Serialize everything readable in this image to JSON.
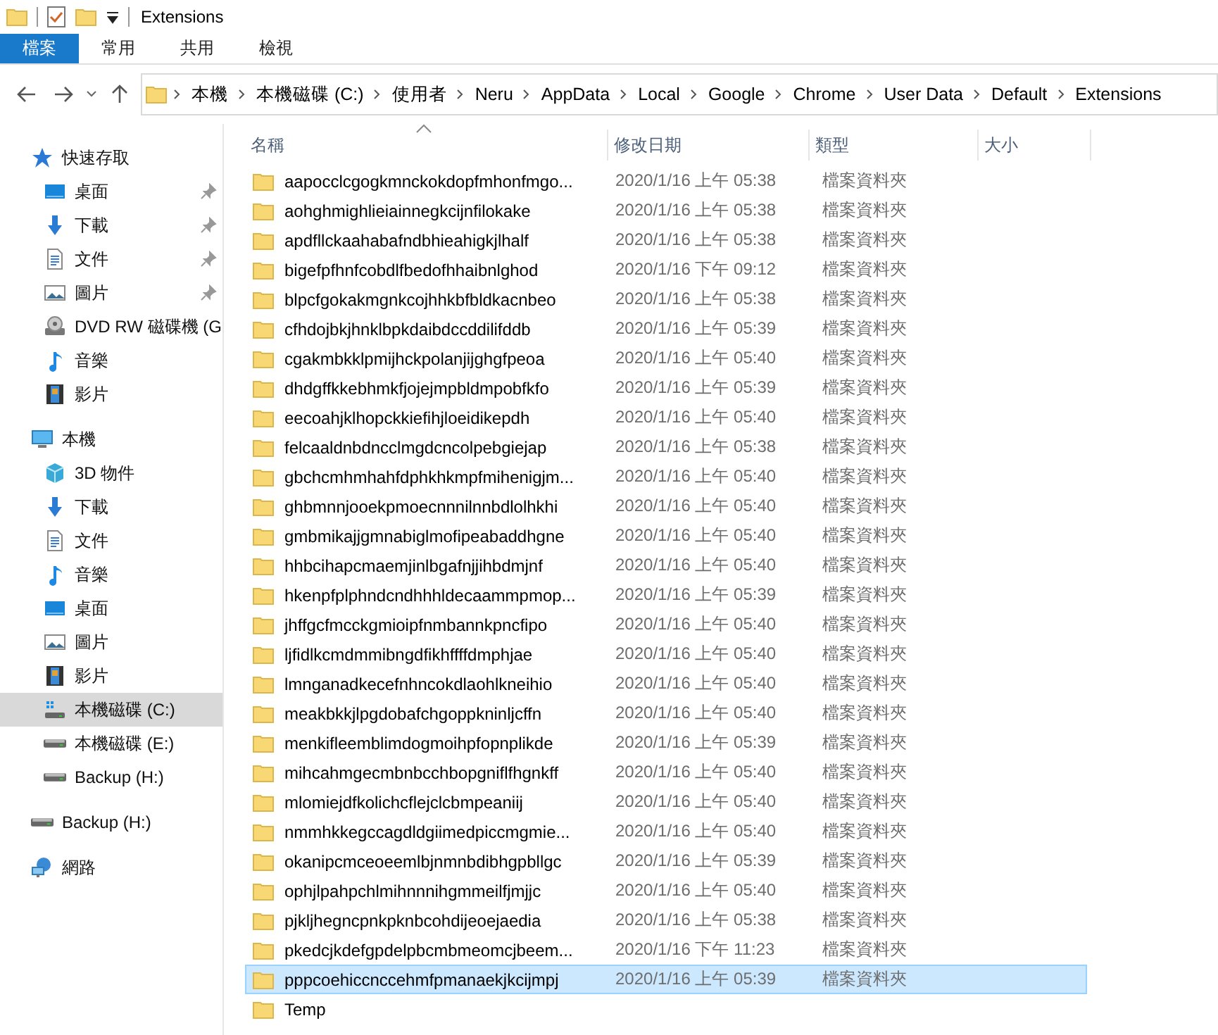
{
  "window": {
    "title": "Extensions"
  },
  "ribbon_tabs": [
    {
      "label": "檔案",
      "selected": true
    },
    {
      "label": "常用",
      "selected": false
    },
    {
      "label": "共用",
      "selected": false
    },
    {
      "label": "檢視",
      "selected": false
    }
  ],
  "address_bar": {
    "segments": [
      "本機",
      "本機磁碟 (C:)",
      "使用者",
      "Neru",
      "AppData",
      "Local",
      "Google",
      "Chrome",
      "User Data",
      "Default",
      "Extensions"
    ]
  },
  "sidebar": {
    "items": [
      {
        "label": "快速存取",
        "kind": "star",
        "selected": false,
        "children": [
          {
            "label": "桌面",
            "kind": "desktop",
            "pinned": true,
            "selected": false
          },
          {
            "label": "下載",
            "kind": "download",
            "pinned": true,
            "selected": false
          },
          {
            "label": "文件",
            "kind": "document",
            "pinned": true,
            "selected": false
          },
          {
            "label": "圖片",
            "kind": "pictures",
            "pinned": true,
            "selected": false
          },
          {
            "label": "DVD RW 磁碟機 (G",
            "kind": "disc",
            "pinned": false,
            "selected": false
          },
          {
            "label": "音樂",
            "kind": "music",
            "pinned": false,
            "selected": false
          },
          {
            "label": "影片",
            "kind": "video",
            "pinned": false,
            "selected": false
          }
        ]
      },
      {
        "label": "本機",
        "kind": "pc",
        "selected": false,
        "children": [
          {
            "label": "3D 物件",
            "kind": "cube",
            "selected": false
          },
          {
            "label": "下載",
            "kind": "download",
            "selected": false
          },
          {
            "label": "文件",
            "kind": "document",
            "selected": false
          },
          {
            "label": "音樂",
            "kind": "music",
            "selected": false
          },
          {
            "label": "桌面",
            "kind": "desktop",
            "selected": false
          },
          {
            "label": "圖片",
            "kind": "pictures",
            "selected": false
          },
          {
            "label": "影片",
            "kind": "video",
            "selected": false
          },
          {
            "label": "本機磁碟 (C:)",
            "kind": "system-drive",
            "selected": true
          },
          {
            "label": "本機磁碟 (E:)",
            "kind": "drive",
            "selected": false
          },
          {
            "label": "Backup  (H:)",
            "kind": "drive",
            "selected": false
          }
        ]
      },
      {
        "label": "Backup  (H:)",
        "kind": "drive",
        "selected": false
      },
      {
        "label": "網路",
        "kind": "network",
        "selected": false
      }
    ]
  },
  "table": {
    "columns": [
      "名稱",
      "修改日期",
      "類型",
      "大小"
    ],
    "rows": [
      {
        "name": "aapocclcgogkmnckokdopfmhonfmgo...",
        "date": "2020/1/16 上午 05:38",
        "type": "檔案資料夾",
        "selected": false
      },
      {
        "name": "aohghmighlieiainnegkcijnfilokake",
        "date": "2020/1/16 上午 05:38",
        "type": "檔案資料夾",
        "selected": false
      },
      {
        "name": "apdfllckaahabafndbhieahigkjlhalf",
        "date": "2020/1/16 上午 05:38",
        "type": "檔案資料夾",
        "selected": false
      },
      {
        "name": "bigefpfhnfcobdlfbedofhhaibnlghod",
        "date": "2020/1/16 下午 09:12",
        "type": "檔案資料夾",
        "selected": false
      },
      {
        "name": "blpcfgokakmgnkcojhhkbfbldkacnbeo",
        "date": "2020/1/16 上午 05:38",
        "type": "檔案資料夾",
        "selected": false
      },
      {
        "name": "cfhdojbkjhnklbpkdaibdccddilifddb",
        "date": "2020/1/16 上午 05:39",
        "type": "檔案資料夾",
        "selected": false
      },
      {
        "name": "cgakmbkklpmijhckpolanjijghgfpeoa",
        "date": "2020/1/16 上午 05:40",
        "type": "檔案資料夾",
        "selected": false
      },
      {
        "name": "dhdgffkkebhmkfjojejmpbldmpobfkfo",
        "date": "2020/1/16 上午 05:39",
        "type": "檔案資料夾",
        "selected": false
      },
      {
        "name": "eecoahjklhopckkiefihjloeidikepdh",
        "date": "2020/1/16 上午 05:40",
        "type": "檔案資料夾",
        "selected": false
      },
      {
        "name": "felcaaldnbdncclmgdcncolpebgiejap",
        "date": "2020/1/16 上午 05:38",
        "type": "檔案資料夾",
        "selected": false
      },
      {
        "name": "gbchcmhmhahfdphkhkmpfmihenigjm...",
        "date": "2020/1/16 上午 05:40",
        "type": "檔案資料夾",
        "selected": false
      },
      {
        "name": "ghbmnnjooekpmoecnnnilnnbdlolhkhi",
        "date": "2020/1/16 上午 05:40",
        "type": "檔案資料夾",
        "selected": false
      },
      {
        "name": "gmbmikajjgmnabiglmofipeabaddhgne",
        "date": "2020/1/16 上午 05:40",
        "type": "檔案資料夾",
        "selected": false
      },
      {
        "name": "hhbcihapcmaemjinlbgafnjjihbdmjnf",
        "date": "2020/1/16 上午 05:40",
        "type": "檔案資料夾",
        "selected": false
      },
      {
        "name": "hkenpfplphndcndhhhldecaammpmop...",
        "date": "2020/1/16 上午 05:39",
        "type": "檔案資料夾",
        "selected": false
      },
      {
        "name": "jhffgcfmcckgmioipfnmbannkpncfipo",
        "date": "2020/1/16 上午 05:40",
        "type": "檔案資料夾",
        "selected": false
      },
      {
        "name": "ljfidlkcmdmmibngdfikhffffdmphjae",
        "date": "2020/1/16 上午 05:40",
        "type": "檔案資料夾",
        "selected": false
      },
      {
        "name": "lmnganadkecefnhncokdlaohlkneihio",
        "date": "2020/1/16 上午 05:40",
        "type": "檔案資料夾",
        "selected": false
      },
      {
        "name": "meakbkkjlpgdobafchgoppkninljcffn",
        "date": "2020/1/16 上午 05:40",
        "type": "檔案資料夾",
        "selected": false
      },
      {
        "name": "menkifleemblimdogmoihpfopnplikde",
        "date": "2020/1/16 上午 05:39",
        "type": "檔案資料夾",
        "selected": false
      },
      {
        "name": "mihcahmgecmbnbcchbopgniflfhgnkff",
        "date": "2020/1/16 上午 05:40",
        "type": "檔案資料夾",
        "selected": false
      },
      {
        "name": "mlomiejdfkolichcflejclcbmpeaniij",
        "date": "2020/1/16 上午 05:40",
        "type": "檔案資料夾",
        "selected": false
      },
      {
        "name": "nmmhkkegccagdldgiimedpiccmgmie...",
        "date": "2020/1/16 上午 05:40",
        "type": "檔案資料夾",
        "selected": false
      },
      {
        "name": "okanipcmceoeemlbjnmnbdibhgpbllgc",
        "date": "2020/1/16 上午 05:39",
        "type": "檔案資料夾",
        "selected": false
      },
      {
        "name": "ophjlpahpchlmihnnnihgmmeilfjmjjc",
        "date": "2020/1/16 上午 05:40",
        "type": "檔案資料夾",
        "selected": false
      },
      {
        "name": "pjkljhegncpnkpknbcohdijeoejaedia",
        "date": "2020/1/16 上午 05:38",
        "type": "檔案資料夾",
        "selected": false
      },
      {
        "name": "pkedcjkdefgpdelpbcmbmeomcjbeem...",
        "date": "2020/1/16 下午 11:23",
        "type": "檔案資料夾",
        "selected": false
      },
      {
        "name": "pppcoehiccnccehmfpmanaekjkcijmpj",
        "date": "2020/1/16 上午 05:39",
        "type": "檔案資料夾",
        "selected": true
      },
      {
        "name": "Temp",
        "selected": false
      }
    ]
  }
}
